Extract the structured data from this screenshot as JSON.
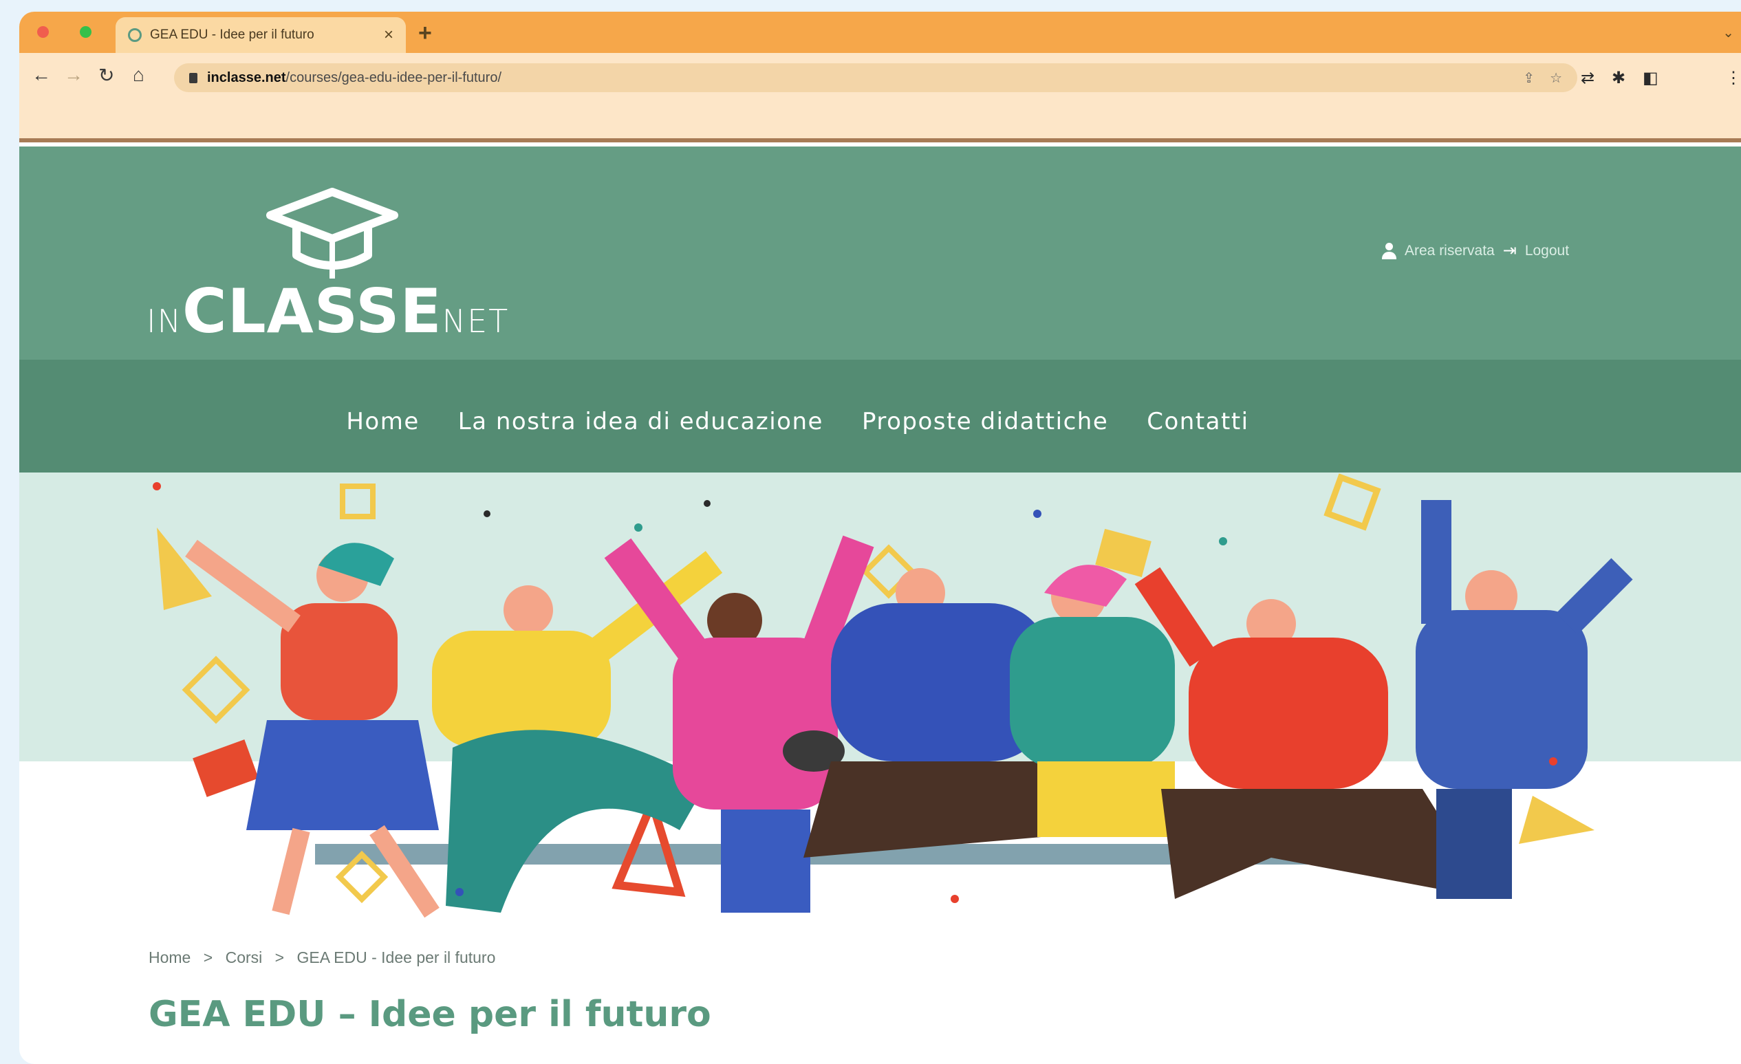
{
  "browser": {
    "tab_title": "GEA EDU - Idee per il futuro",
    "url_host": "inclasse.net",
    "url_path": "/courses/gea-edu-idee-per-il-futuro/"
  },
  "site": {
    "logo": {
      "in": "IN",
      "classe": "CLASSE",
      "net": "NET"
    },
    "user": {
      "name": "Area riservata",
      "logout": "Logout"
    },
    "nav": [
      {
        "label": "Home"
      },
      {
        "label": "La nostra idea di educazione"
      },
      {
        "label": "Proposte didattiche"
      },
      {
        "label": "Contatti"
      }
    ]
  },
  "breadcrumb": [
    "Home",
    ">",
    "Corsi",
    ">",
    "GEA EDU - Idee per il futuro"
  ],
  "page_title": "GEA EDU – Idee per il futuro",
  "colors": {
    "tabbar": "#f6a74a",
    "header_green": "#659d84",
    "nav_green": "#548c73",
    "title_green": "#5a9a80"
  }
}
